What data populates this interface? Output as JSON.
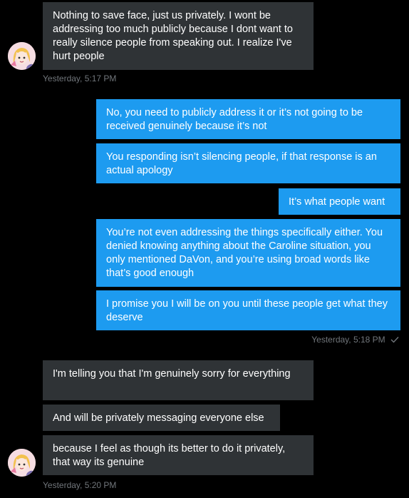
{
  "thread": {
    "colors": {
      "background": "#000000",
      "incoming_bubble": "#2f3336",
      "outgoing_bubble": "#1d9bf0",
      "timestamp": "#71767b"
    },
    "messages": [
      {
        "direction": "incoming",
        "text": "Nothing to save face, just us privately. I wont be addressing too much publicly because I dont want to really silence people from speaking out. I realize I've hurt people"
      },
      {
        "direction": "outgoing",
        "text": "No, you need to publicly address it or it’s not going to be received genuinely because it’s not"
      },
      {
        "direction": "outgoing",
        "text": "You responding isn’t silencing people, if that response is an actual apology"
      },
      {
        "direction": "outgoing",
        "text": "It’s what people want"
      },
      {
        "direction": "outgoing",
        "text": "You’re not even addressing the things specifically either. You denied knowing anything about the Caroline situation, you only mentioned DaVon, and you’re using broad words like that’s good enough"
      },
      {
        "direction": "outgoing",
        "text": "I promise you I will be on you until these people get what they deserve"
      },
      {
        "direction": "incoming",
        "text": "I'm telling you that I'm genuinely sorry for everything"
      },
      {
        "direction": "incoming",
        "text": "And will be privately messaging everyone else"
      },
      {
        "direction": "incoming",
        "text": "because I feel as though its better to do it privately, that way its genuine"
      }
    ],
    "timestamps": {
      "first": "Yesterday, 5:17 PM",
      "second": "Yesterday, 5:18 PM",
      "third": "Yesterday, 5:20 PM"
    },
    "icons": {
      "avatar": "user-avatar",
      "read_receipt": "checkmark-icon"
    }
  }
}
